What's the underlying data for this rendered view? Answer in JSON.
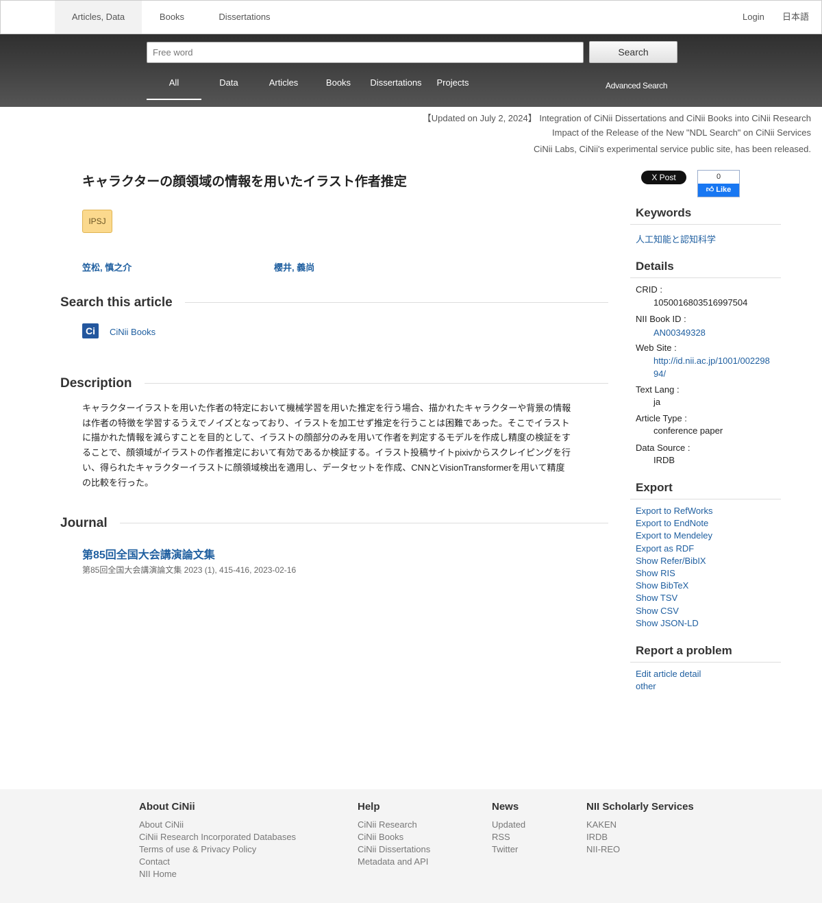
{
  "topnav": {
    "tabs": [
      "Articles, Data",
      "Books",
      "Dissertations"
    ],
    "login": "Login",
    "lang": "日本語"
  },
  "search": {
    "placeholder": "Free word",
    "button": "Search",
    "subtabs": [
      "All",
      "Data",
      "Articles",
      "Books",
      "Dissertations",
      "Projects"
    ],
    "advanced": "Advanced Search"
  },
  "announcements": [
    "【Updated on July 2, 2024】 Integration of CiNii Dissertations and CiNii Books into CiNii Research",
    "Impact of the Release of the New \"NDL Search\" on CiNii Services",
    "CiNii Labs, CiNii's experimental service public site, has been released."
  ],
  "article": {
    "title": "キャラクターの顔領域の情報を用いたイラスト作者推定",
    "badge": "IPSJ",
    "authors": [
      "笠松, 慎之介",
      "櫻井, 義尚"
    ]
  },
  "sections": {
    "search_this": "Search this article",
    "description": "Description",
    "journal": "Journal"
  },
  "search_links": {
    "logo_text": "Ci",
    "cinii_books": "CiNii Books"
  },
  "description": {
    "lines": [
      "キャラクターイラストを用いた作者の特定において機械学習を用いた推定を行う場合、描かれたキャラクターや背景の情報",
      "は作者の特徴を学習するうえでノイズとなっており、イラストを加工せず推定を行うことは困難であった。そこでイラスト",
      "に描かれた情報を減らすことを目的として、イラストの顔部分のみを用いて作者を判定するモデルを作成し精度の検証をす",
      "ることで、顔領域がイラストの作者推定において有効であるか検証する。イラスト投稿サイトpixivからスクレイピングを行",
      "い、得られたキャラクターイラストに顔領域検出を適用し、データセットを作成、CNNとVisionTransformerを用いて精度",
      "の比較を行った。"
    ]
  },
  "journal": {
    "title": "第85回全国大会講演論文集",
    "meta": "第85回全国大会講演論文集 2023 (1), 415-416, 2023-02-16"
  },
  "social": {
    "post": "X Post",
    "like_count": "0",
    "like": "Like"
  },
  "sidebar": {
    "keywords_title": "Keywords",
    "keyword": "人工知能と認知科学",
    "details_title": "Details",
    "details": {
      "crid_label": "CRID :",
      "crid": "1050016803516997504",
      "bookid_label": "NII Book ID :",
      "bookid": "AN00349328",
      "website_label": "Web Site :",
      "website": "http://id.nii.ac.jp/1001/00229894/",
      "textlang_label": "Text Lang :",
      "textlang": "ja",
      "type_label": "Article Type :",
      "type": "conference paper",
      "source_label": "Data Source :",
      "source": "IRDB"
    },
    "export_title": "Export",
    "export_links": [
      "Export to RefWorks",
      "Export to EndNote",
      "Export to Mendeley",
      "Export as RDF",
      "Show Refer/BibIX",
      "Show RIS",
      "Show BibTeX",
      "Show TSV",
      "Show CSV",
      "Show JSON-LD"
    ],
    "report_title": "Report a problem",
    "report_links": [
      "Edit article detail",
      "other"
    ]
  },
  "footer": {
    "cols": [
      {
        "title": "About CiNii",
        "links": [
          "About CiNii",
          "CiNii Research Incorporated Databases",
          "Terms of use & Privacy Policy",
          "Contact",
          "NII Home"
        ]
      },
      {
        "title": "Help",
        "links": [
          "CiNii Research",
          "CiNii Books",
          "CiNii Dissertations",
          "Metadata and API"
        ]
      },
      {
        "title": "News",
        "links": [
          "Updated",
          "RSS",
          "Twitter"
        ]
      },
      {
        "title": "NII Scholarly Services",
        "links": [
          "KAKEN",
          "IRDB",
          "NII-REO"
        ]
      }
    ]
  }
}
